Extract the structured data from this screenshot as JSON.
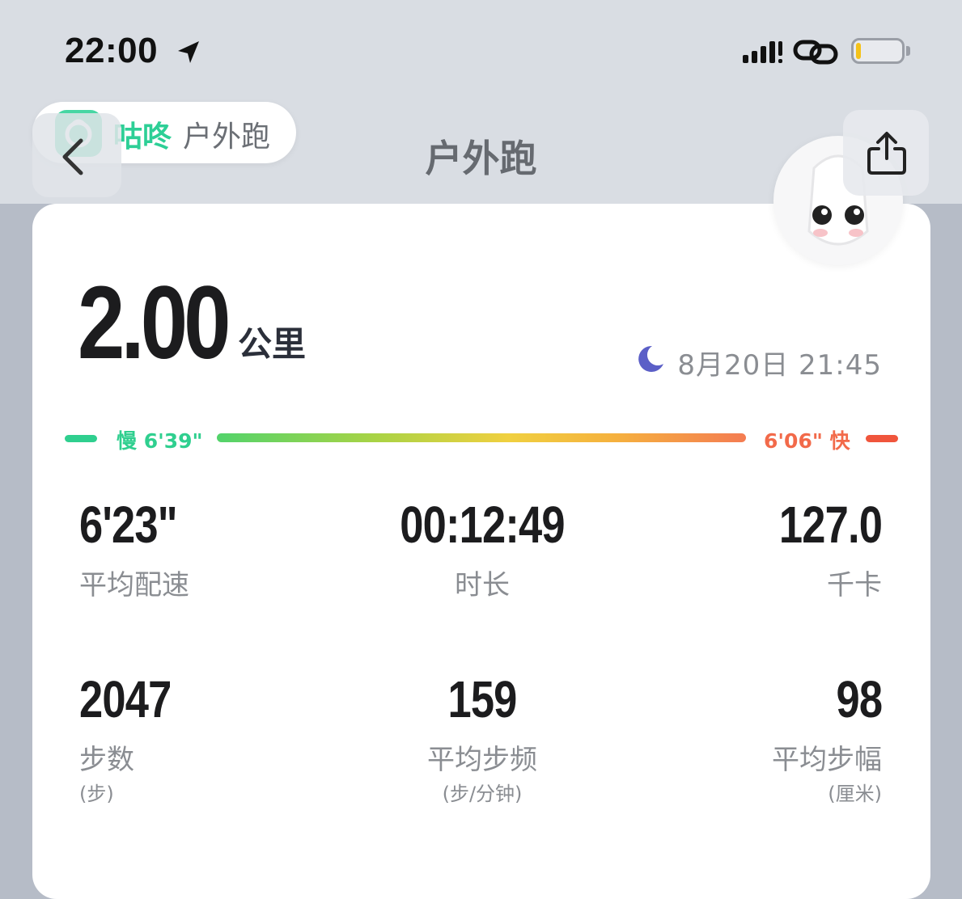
{
  "status_bar": {
    "time": "22:00",
    "icons": [
      "location-arrow-icon",
      "signal-icon",
      "link-icon",
      "battery-icon"
    ],
    "battery_level": 0.12,
    "battery_color": "#f4c21a"
  },
  "app_pill": {
    "app_name": "咕咚",
    "subtitle": "户外跑",
    "brand_color": "#2dcf96"
  },
  "header": {
    "title": "户外跑",
    "back_icon": "chevron-left-icon",
    "share_icon": "share-icon"
  },
  "summary": {
    "distance": "2.00",
    "distance_unit": "公里",
    "time_icon": "moon-icon",
    "datetime": "8月20日 21:45"
  },
  "pace_bar": {
    "slow_label": "慢 6'39\"",
    "fast_label": "6'06\" 快",
    "slow_color": "#2fcf8f",
    "fast_color": "#f26a4a"
  },
  "stats": [
    {
      "value": "6'23\"",
      "label": "平均配速",
      "unit": ""
    },
    {
      "value": "00:12:49",
      "label": "时长",
      "unit": ""
    },
    {
      "value": "127.0",
      "label": "千卡",
      "unit": ""
    },
    {
      "value": "2047",
      "label": "步数",
      "unit": "(步)"
    },
    {
      "value": "159",
      "label": "平均步频",
      "unit": "(步/分钟)"
    },
    {
      "value": "98",
      "label": "平均步幅",
      "unit": "(厘米)"
    }
  ]
}
